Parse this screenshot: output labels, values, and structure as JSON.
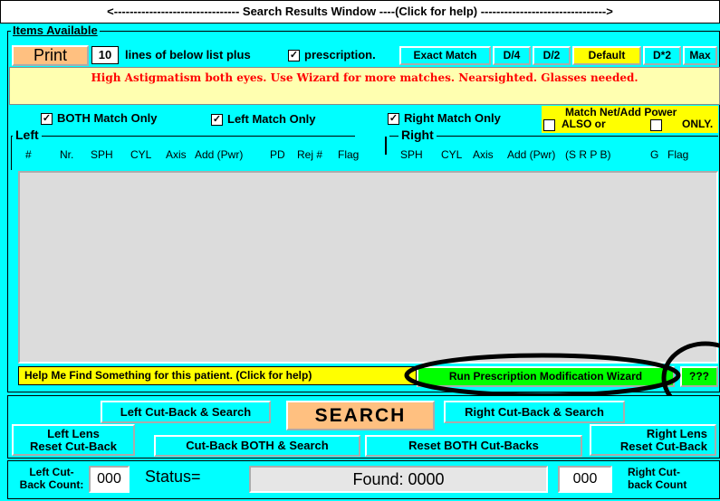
{
  "title_bar": "<-------------------------------- Search Results Window ----(Click for help) -------------------------------->",
  "items_available": "Items Available",
  "print": {
    "label": "Print",
    "lines": "10",
    "lines_label": "lines of below list plus",
    "prescription_checked": true,
    "prescription_label": "prescription."
  },
  "match_buttons": [
    "Exact Match",
    "D/4",
    "D/2",
    "Default",
    "D*2",
    "Max"
  ],
  "message": "High Astigmatism both eyes. Use Wizard for more matches. Nearsighted. Glasses needed.",
  "filters": {
    "both": {
      "label": "BOTH Match Only",
      "checked": true
    },
    "left": {
      "label": "Left Match Only",
      "checked": true
    },
    "right": {
      "label": "Right Match Only",
      "checked": true
    },
    "net_add_title": "Match Net/Add Power",
    "also_label": "ALSO or",
    "only_label": "ONLY.",
    "also_checked": false,
    "only_checked": false
  },
  "left_header": "Left",
  "right_header": "Right",
  "left_columns": [
    "#",
    "Nr.",
    "SPH",
    "CYL",
    "Axis",
    "Add (Pwr)",
    "PD",
    "Rej #",
    "Flag"
  ],
  "right_columns": [
    "SPH",
    "CYL",
    "Axis",
    "Add (Pwr)",
    "(S R P B)",
    "G",
    "Flag"
  ],
  "help_bar": "Help Me Find Something for this patient. (Click for help)",
  "wizard_button": "Run Prescription Modification Wizard",
  "qqq_button": "???",
  "left_cutback_search": "Left Cut-Back & Search",
  "search_button": "SEARCH",
  "right_cutback_search": "Right Cut-Back & Search",
  "left_lens_reset": [
    "Left Lens",
    "Reset Cut-Back"
  ],
  "right_lens_reset": [
    "Right Lens",
    "Reset Cut-Back"
  ],
  "cutback_both_search": "Cut-Back BOTH & Search",
  "reset_both_cutbacks": "Reset BOTH Cut-Backs",
  "left_count_label": [
    "Left Cut-",
    "Back Count:"
  ],
  "left_count": "000",
  "status_label": "Status=",
  "found_text": "Found: 0000",
  "right_count": "000",
  "right_count_label": [
    "Right Cut-",
    "back Count"
  ],
  "colors": {
    "panel": "#00ffff",
    "yellow": "#ffff00",
    "green": "#00ff00",
    "print_orange": "#ffc080",
    "message_red": "#ff0000",
    "list_gray": "#dcdcdc"
  }
}
